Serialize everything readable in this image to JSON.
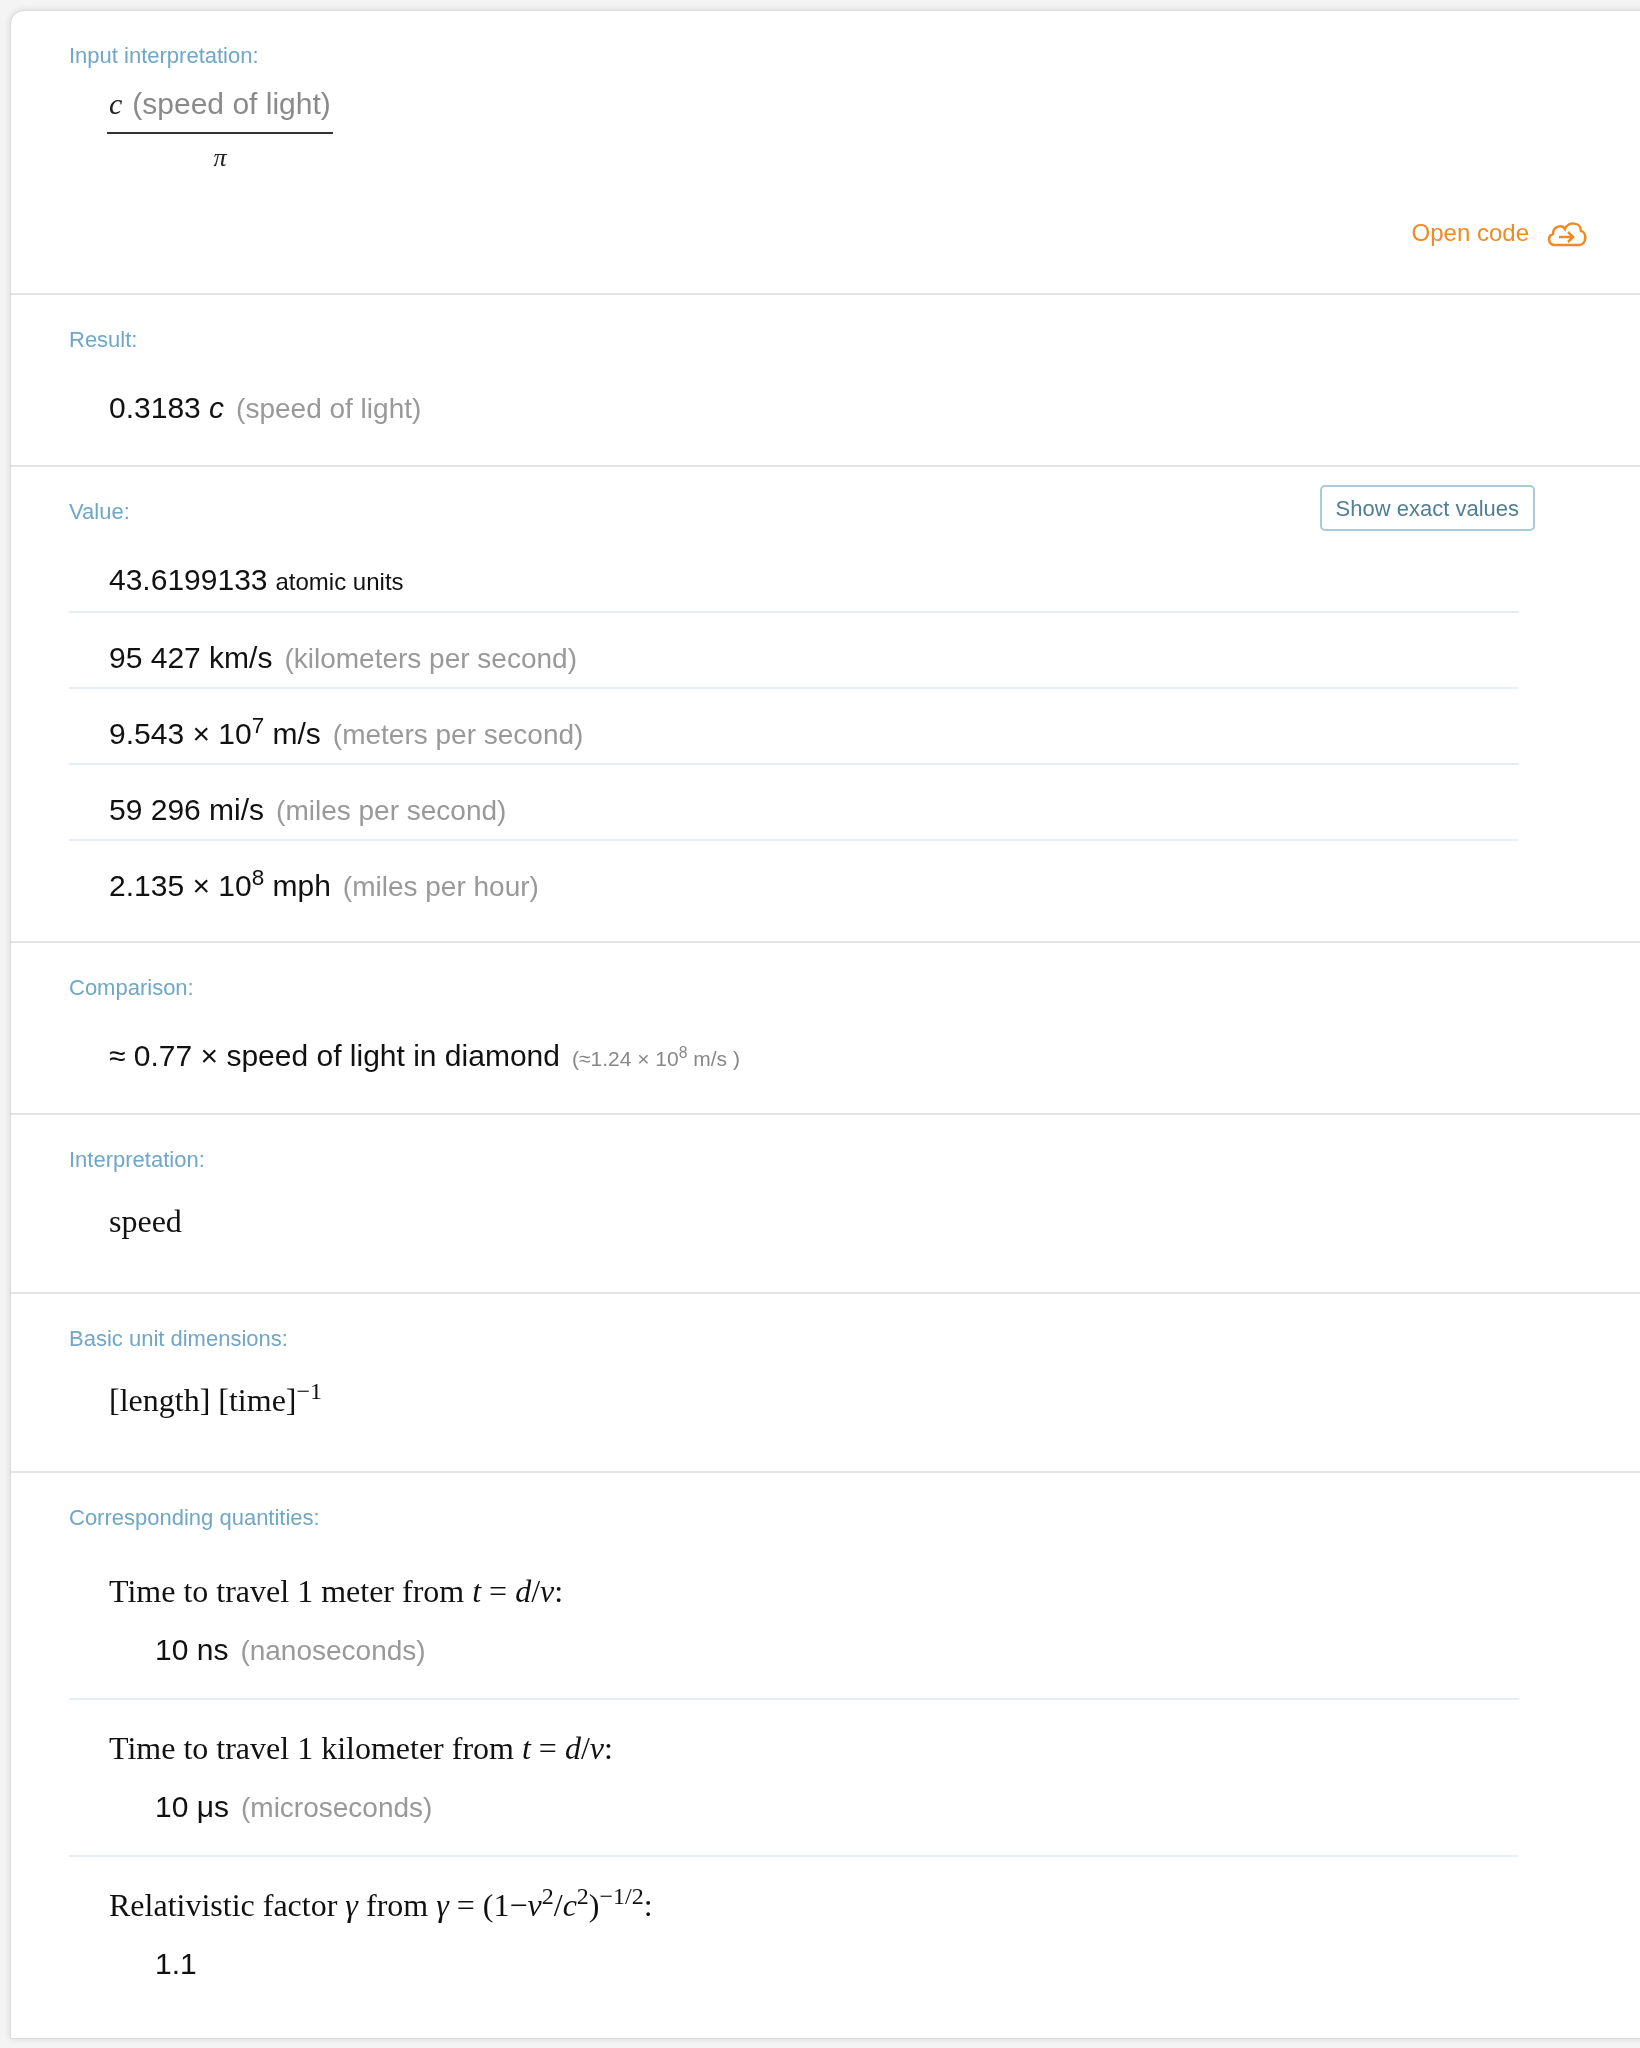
{
  "pods": [
    {
      "kind": "fraction",
      "title": "Input interpretation:",
      "numerator": "*c*",
      "numerator_note": "(speed of light)",
      "denominator": "*π*",
      "link": "Open code"
    },
    {
      "kind": "list",
      "title": "Result:",
      "rows": [
        {
          "value": "0.3183 *c*",
          "note": "(speed of light)"
        }
      ]
    },
    {
      "kind": "list",
      "title": "Value:",
      "button": "Show exact values",
      "rows": [
        {
          "value": "43.6199133",
          "unit": "atomic units"
        },
        {
          "value": "95 427 km/s",
          "note": "(kilometers per second)"
        },
        {
          "value": "9.543 × 10$^{7}$ m/s",
          "note": "(meters per second)"
        },
        {
          "value": "59 296 mi/s",
          "note": "(miles per second)"
        },
        {
          "value": "2.135 × 10$^{8}$ mph",
          "note": "(miles per hour)"
        }
      ]
    },
    {
      "kind": "list",
      "title": "Comparison:",
      "rows": [
        {
          "value": "≈ 0.77 × speed of light in diamond",
          "small_note": "(≈1.24 × 10$^{8}$ m/s )"
        }
      ]
    },
    {
      "kind": "serif",
      "title": "Interpretation:",
      "text": "speed"
    },
    {
      "kind": "serif",
      "title": "Basic unit dimensions:",
      "text": "[length] [time]$^{−1}$"
    },
    {
      "kind": "sublist",
      "title": "Corresponding quantities:",
      "items": [
        {
          "label": "Time to travel 1 meter from *t* = *d*/*v*:",
          "value": "10 ns",
          "note": "(nanoseconds)"
        },
        {
          "label": "Time to travel 1 kilometer from *t* = *d*/*v*:",
          "value": "10 μs",
          "note": "(microseconds)"
        },
        {
          "label": "Relativistic factor *γ* from *γ* = (1−*v*$^{2}$/*c*$^{2}$)$^{−1/2}$:",
          "value": "1.1"
        }
      ]
    }
  ]
}
